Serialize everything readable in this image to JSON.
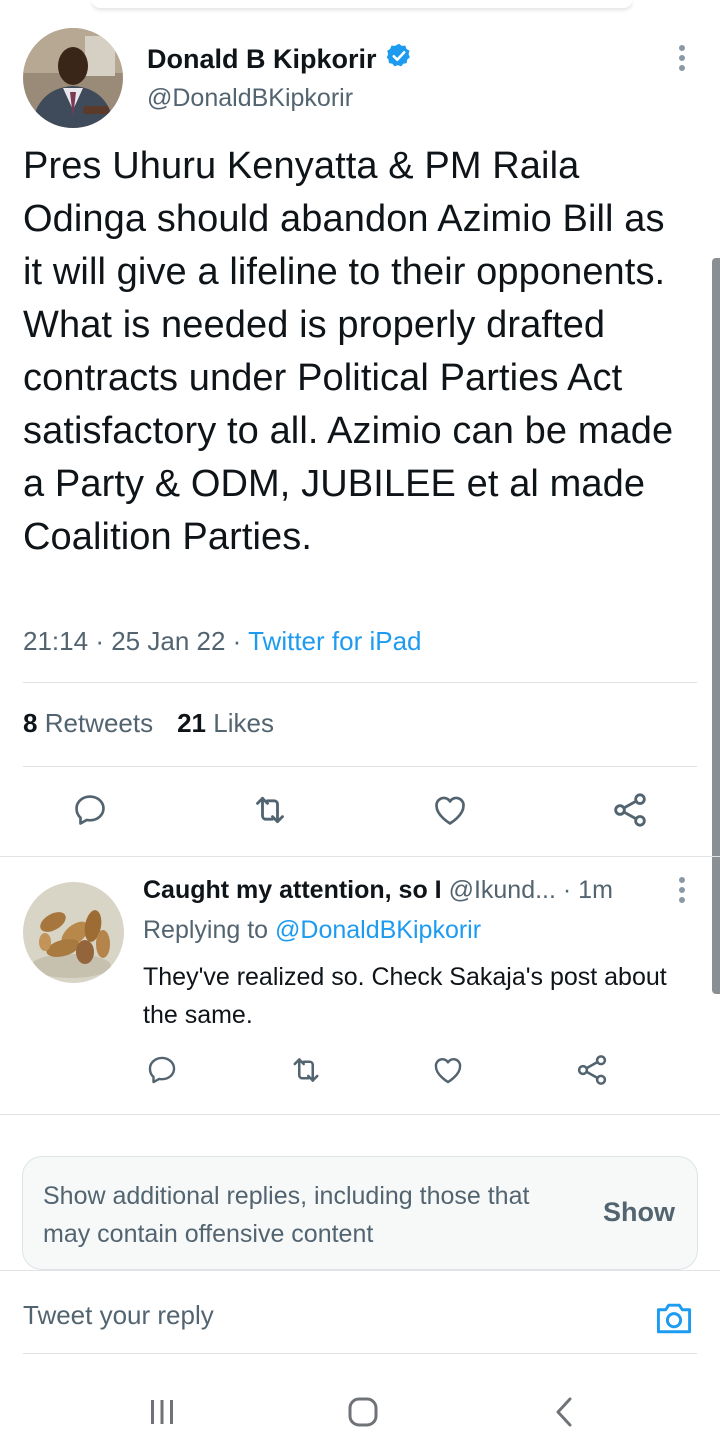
{
  "tweet": {
    "author_name": "Donald B Kipkorir",
    "author_handle": "@DonaldBKipkorir",
    "verified_icon": "verified-badge-icon",
    "text": "Pres Uhuru Kenyatta & PM Raila Odinga should abandon Azimio Bill as it will give a lifeline to their opponents. What is needed is properly drafted contracts under Political Parties Act satisfactory to all. Azimio can be made a Party & ODM, JUBILEE et al made Coalition Parties.",
    "time": "21:14",
    "date": "25 Jan 22",
    "separator": "·",
    "source": "Twitter for iPad",
    "retweets_count": "8",
    "retweets_label": "Retweets",
    "likes_count": "21",
    "likes_label": "Likes"
  },
  "reply": {
    "author_name": "Caught my attention, so I",
    "author_handle": "@Ikund...",
    "time_ago": "· 1m",
    "replying_prefix": "Replying to",
    "replying_to": "@DonaldBKipkorir",
    "text": "They've realized so. Check Sakaja's post about the same."
  },
  "additional_replies": {
    "text": "Show additional replies, including those that may contain offensive content",
    "button": "Show"
  },
  "composer": {
    "placeholder": "Tweet your reply"
  },
  "colors": {
    "accent": "#1d9bf0",
    "text_primary": "#0f1419",
    "text_secondary": "#536471",
    "divider": "#dfe3e6"
  }
}
